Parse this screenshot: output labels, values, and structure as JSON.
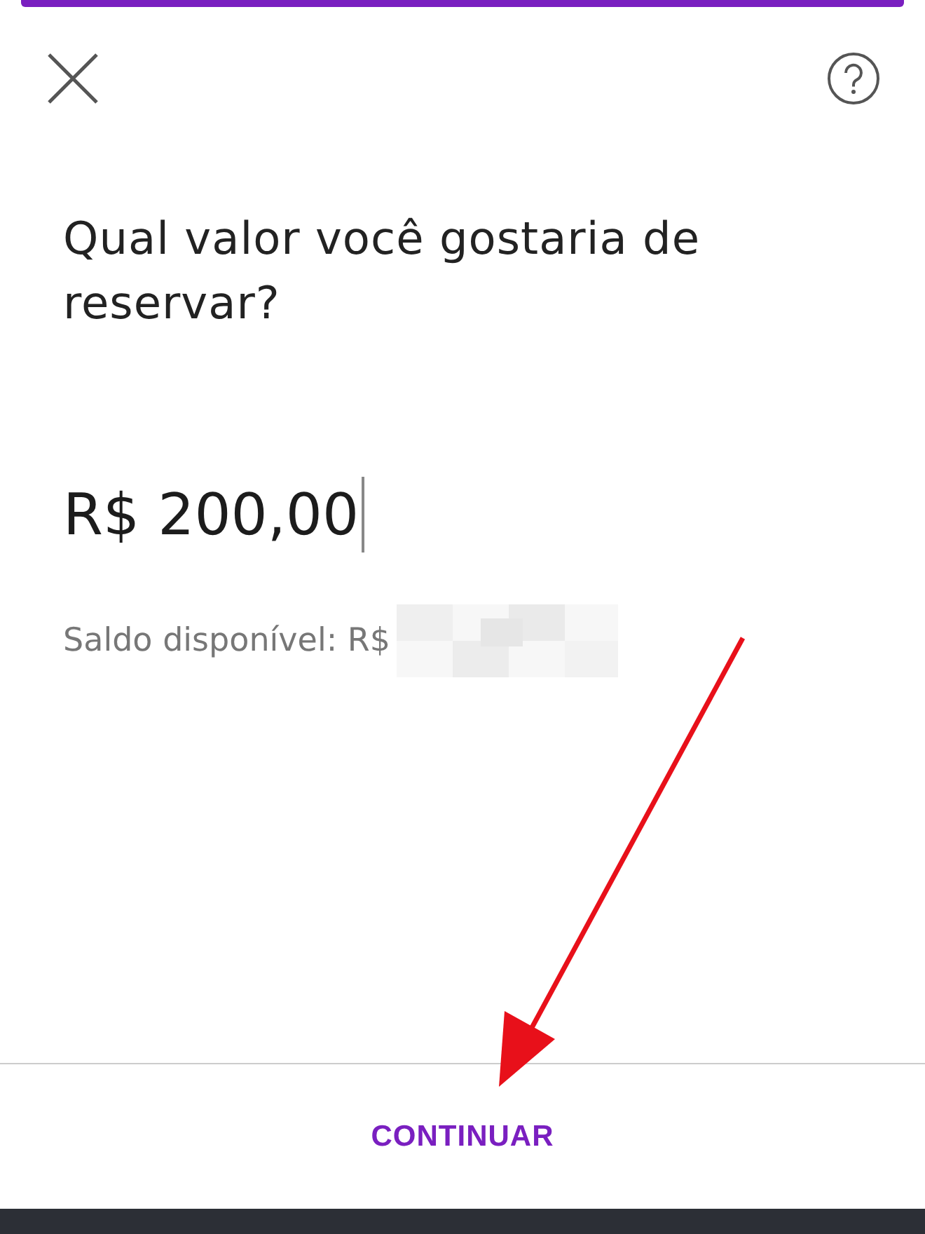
{
  "question": "Qual valor você gostaria de reservar?",
  "amount": {
    "value": "R$ 200,00"
  },
  "balance_label": "Saldo disponível: R$",
  "continue_button": "CONTINUAR"
}
